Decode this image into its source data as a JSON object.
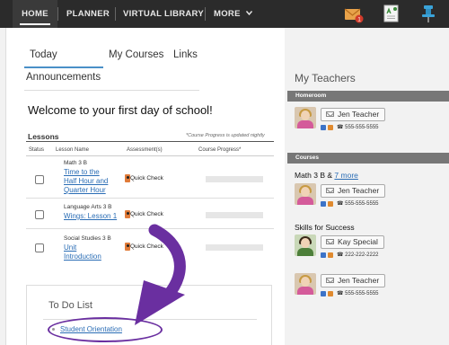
{
  "nav": {
    "home": "HOME",
    "planner": "PLANNER",
    "virtual_library": "VIRTUAL LIBRARY",
    "more": "MORE",
    "mail_badge": "1"
  },
  "tabs": {
    "today": "Today",
    "my_courses": "My Courses",
    "links": "Links",
    "announcements": "Announcements"
  },
  "welcome": "Welcome to your first day of school!",
  "lessons": {
    "title": "Lessons",
    "progress_note": "*Course Progress is updated nightly",
    "headers": {
      "status": "Status",
      "lesson_name": "Lesson Name",
      "assessments": "Assessment(s)",
      "progress": "Course Progress*"
    },
    "rows": [
      {
        "course": "Math 3 B",
        "lesson_lines": [
          "Time to the",
          "Half Hour and",
          "Quarter Hour"
        ],
        "assessment": "Quick Check"
      },
      {
        "course": "Language Arts 3 B",
        "lesson_lines": [
          "Wings: Lesson 1"
        ],
        "assessment": "Quick Check"
      },
      {
        "course": "Social Studies 3 B",
        "lesson_lines": [
          "Unit",
          "Introduction"
        ],
        "assessment": "Quick Check"
      }
    ]
  },
  "todo": {
    "title": "To Do List",
    "items": [
      "Student Orientation"
    ]
  },
  "right": {
    "title": "My Teachers",
    "homeroom_label": "Homeroom",
    "courses_label": "Courses",
    "homeroom_teacher": {
      "name": "Jen Teacher",
      "phone": "555-555-5555"
    },
    "courses": [
      {
        "label": "Math 3 B & ",
        "more": "7 more",
        "teacher": "Jen Teacher",
        "phone": "555-555-5555"
      },
      {
        "label": "Skills for Success",
        "teacher": "Kay Special",
        "phone": "222-222-2222"
      },
      {
        "label": "",
        "teacher": "Jen Teacher",
        "phone": "555-555-5555"
      }
    ]
  },
  "colors": {
    "nav_bg": "#2b2b2b",
    "link": "#2a6db5",
    "highlight_purple": "#6a2fa0",
    "section_bar": "#777777"
  },
  "icons": [
    "mail-icon",
    "grade-report-icon",
    "pin-icon",
    "chevron-down-icon",
    "quick-check-icon",
    "phone-icon"
  ]
}
